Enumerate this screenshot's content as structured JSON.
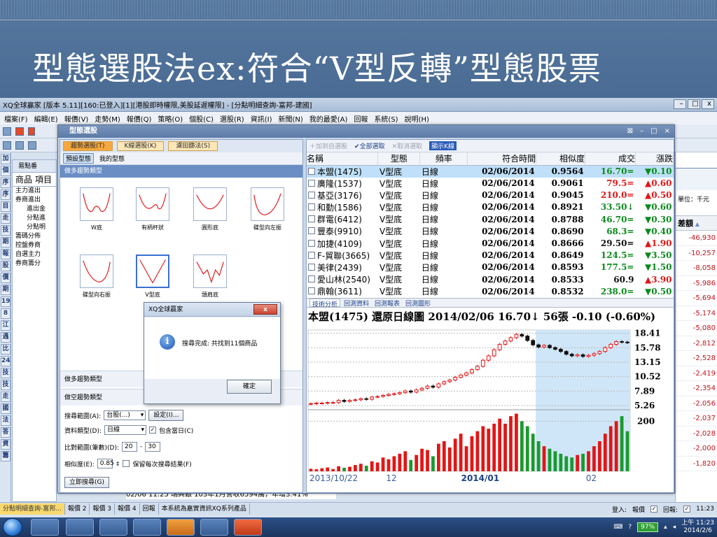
{
  "slide": {
    "title": "型態選股法ex:符合“V型反轉”型態股票"
  },
  "app": {
    "title": "XQ全球贏家 [版本 5.11][160:已登入][1][港股即時權限,美股延遲權限] - [分點明細查詢-富邦-建國]",
    "menu": [
      "檔案(F)",
      "編輯(E)",
      "報價(V)",
      "走勢(M)",
      "報價(Q)",
      "策略(O)",
      "個股(C)",
      "選股(R)",
      "資訊(I)",
      "新聞(N)",
      "我的最愛(A)",
      "回報",
      "系統(S)",
      "說明(H)"
    ],
    "side_buttons": [
      "加",
      "個",
      "序",
      "序",
      "目",
      "走",
      "技",
      "期",
      "報",
      "股",
      "價",
      "期",
      "19",
      "8",
      "江",
      "遇",
      "比",
      "24",
      "技",
      "技",
      "走",
      "國",
      "法",
      "答",
      "資",
      "籌"
    ],
    "tree": {
      "title": "易點番",
      "tabs": [
        "商品",
        "項目"
      ],
      "items": [
        "主力進出",
        "券商進出",
        "進出金",
        "分點進",
        "分點明",
        "籌碼分佈",
        "控盤券商",
        "自選主力",
        "券商籌分"
      ]
    },
    "right_panel": {
      "unit": "單位：千元",
      "header": "差額",
      "values": [
        "-46,930",
        "-10,257",
        "-8,058",
        "-5,986",
        "-5,694",
        "-5,174",
        "-5,080",
        "-2,812",
        "-2,528",
        "-2,419",
        "-2,354",
        "-2,056",
        "-2,037",
        "-2,028",
        "-2,000",
        "-1,820"
      ]
    },
    "news": "02/06 11:25   瑞興銀 103年1月營收6594萬，年增3.41%",
    "tabs": [
      "分點明細查詢-富邦...",
      "報價 2",
      "報價 3",
      "報價 4",
      "回報",
      "本系統為嘉實資訊XQ系列產品"
    ],
    "status": {
      "login": "登入:",
      "quote": "報價",
      "reply": "回報:",
      "time": "11:23"
    }
  },
  "dialog": {
    "title": "型態選股",
    "left_tabs": [
      "趨勢選股(T)",
      "K線選股(K)",
      "濾田篩法(S)"
    ],
    "left_toolbar": [
      "預設型態",
      "我的型態"
    ],
    "left_header": "做多趨勢類型",
    "patterns": [
      {
        "label": "W底"
      },
      {
        "label": "有柄杯狀"
      },
      {
        "label": "圓形底"
      },
      {
        "label": "碟型向左振"
      },
      {
        "label": "碟型向右振"
      },
      {
        "label": "V型底"
      },
      {
        "label": "頭肩底"
      }
    ],
    "section_long": "做多趨勢類型",
    "section_short": "做空趨勢類型",
    "form": {
      "range_label": "搜尋範圍(A):",
      "range_value": "台股(...)",
      "settings_btn": "設定(I)...",
      "data_label": "資料類型(D):",
      "data_value": "日線",
      "include_today": "包含當日(C)",
      "compare_label": "比對範圍(筆數)(D):",
      "compare_from": "20",
      "compare_to": "30",
      "similarity_label": "相似度(E):",
      "similarity_value": "0.85",
      "keep_label": "保留每次搜尋結果(F)",
      "search_btn": "立即搜尋(G)"
    },
    "right_toolbar": {
      "add": "加到自選股",
      "select_all": "全部選取",
      "cancel": "取消選取",
      "chart": "顯示K線"
    },
    "table_headers": [
      "名稱",
      "型態",
      "頻率",
      "符合時間",
      "相似度",
      "成交",
      "漲跌"
    ],
    "rows": [
      {
        "name": "本盟(1475)",
        "type": "V型底",
        "freq": "日線",
        "date": "02/06/2014",
        "sim": "0.9564",
        "price": "16.70=",
        "pdir": "down",
        "chg": "▼0.10",
        "cdir": "down"
      },
      {
        "name": "廣隆(1537)",
        "type": "V型底",
        "freq": "日線",
        "date": "02/06/2014",
        "sim": "0.9061",
        "price": "79.5=",
        "pdir": "up",
        "chg": "▲0.60",
        "cdir": "up"
      },
      {
        "name": "基亞(3176)",
        "type": "V型底",
        "freq": "日線",
        "date": "02/06/2014",
        "sim": "0.9045",
        "price": "210.0=",
        "pdir": "up",
        "chg": "▲0.50",
        "cdir": "up"
      },
      {
        "name": "和勤(1586)",
        "type": "V型底",
        "freq": "日線",
        "date": "02/06/2014",
        "sim": "0.8921",
        "price": "33.50↓",
        "pdir": "down",
        "chg": "▼0.60",
        "cdir": "down"
      },
      {
        "name": "群電(6412)",
        "type": "V型底",
        "freq": "日線",
        "date": "02/06/2014",
        "sim": "0.8788",
        "price": "46.70=",
        "pdir": "down",
        "chg": "▼0.30",
        "cdir": "down"
      },
      {
        "name": "豐泰(9910)",
        "type": "V型底",
        "freq": "日線",
        "date": "02/06/2014",
        "sim": "0.8690",
        "price": "68.3=",
        "pdir": "down",
        "chg": "▼0.40",
        "cdir": "down"
      },
      {
        "name": "加捷(4109)",
        "type": "V型底",
        "freq": "日線",
        "date": "02/06/2014",
        "sim": "0.8666",
        "price": "29.50=",
        "pdir": "flat",
        "chg": "▲1.90",
        "cdir": "up"
      },
      {
        "name": "F-貿聯(3665)",
        "type": "V型底",
        "freq": "日線",
        "date": "02/06/2014",
        "sim": "0.8649",
        "price": "124.5=",
        "pdir": "down",
        "chg": "▼3.50",
        "cdir": "down"
      },
      {
        "name": "美律(2439)",
        "type": "V型底",
        "freq": "日線",
        "date": "02/06/2014",
        "sim": "0.8593",
        "price": "177.5=",
        "pdir": "down",
        "chg": "▼1.50",
        "cdir": "down"
      },
      {
        "name": "愛山林(2540)",
        "type": "V型底",
        "freq": "日線",
        "date": "02/06/2014",
        "sim": "0.8533",
        "price": "60.9",
        "pdir": "flat",
        "chg": "▲3.90",
        "cdir": "up"
      },
      {
        "name": "鼎翰(3611)",
        "type": "V型底",
        "freq": "日線",
        "date": "02/06/2014",
        "sim": "0.8532",
        "price": "238.0=",
        "pdir": "down",
        "chg": "▼0.50",
        "cdir": "down"
      }
    ],
    "chart_tabs": [
      "技術分析",
      "回測資料",
      "回測報表",
      "回測圖形"
    ],
    "chart_header": "本盟(1475)  還原日線圖  2014/02/06  16.70↓  56張  -0.10 (-0.60%)"
  },
  "msgbox": {
    "title": "XQ全球贏家",
    "text": "搜尋完成: 共找到11個商品",
    "ok": "確定",
    "close": "x"
  },
  "tray": {
    "battery": "97%",
    "time": "上午 11:23",
    "date": "2014/2/6"
  },
  "chart_data": {
    "type": "candlestick",
    "price_ticks": [
      "18.41",
      "15.78",
      "13.15",
      "10.52",
      "7.89",
      "5.26"
    ],
    "volume_tick": "200",
    "x_ticks": [
      "2013/10/22",
      "12",
      "2014/01",
      "02"
    ],
    "colors": {
      "up": "#e21616",
      "down": "#111111",
      "volume_up": "#e21616",
      "volume_down": "#1a9a2e",
      "highlight": "#cfe6f8"
    },
    "close": [
      5.6,
      5.7,
      5.7,
      5.8,
      5.8,
      6.2,
      6.0,
      6.2,
      6.3,
      6.5,
      6.4,
      6.8,
      6.9,
      7.1,
      7.3,
      7.4,
      7.6,
      7.9,
      7.7,
      8.1,
      8.4,
      8.8,
      8.6,
      9.2,
      9.6,
      9.9,
      10.4,
      10.8,
      11.2,
      11.8,
      12.4,
      13.5,
      14.3,
      15.4,
      16.4,
      17.0,
      17.6,
      18.2,
      17.9,
      17.1,
      16.3,
      15.9,
      16.2,
      15.8,
      15.5,
      15.1,
      14.6,
      14.3,
      14.5,
      14.2,
      14.4,
      14.7,
      15.1,
      15.8,
      16.4,
      16.9,
      16.8,
      16.7
    ],
    "volume": [
      10,
      8,
      12,
      15,
      9,
      20,
      14,
      18,
      25,
      30,
      22,
      40,
      35,
      55,
      48,
      60,
      70,
      80,
      45,
      65,
      90,
      85,
      60,
      110,
      120,
      95,
      130,
      150,
      100,
      140,
      160,
      180,
      170,
      190,
      210,
      190,
      220,
      230,
      200,
      180,
      150,
      120,
      100,
      90,
      80,
      70,
      60,
      55,
      65,
      70,
      80,
      100,
      120,
      150,
      180,
      200,
      220,
      160
    ]
  }
}
